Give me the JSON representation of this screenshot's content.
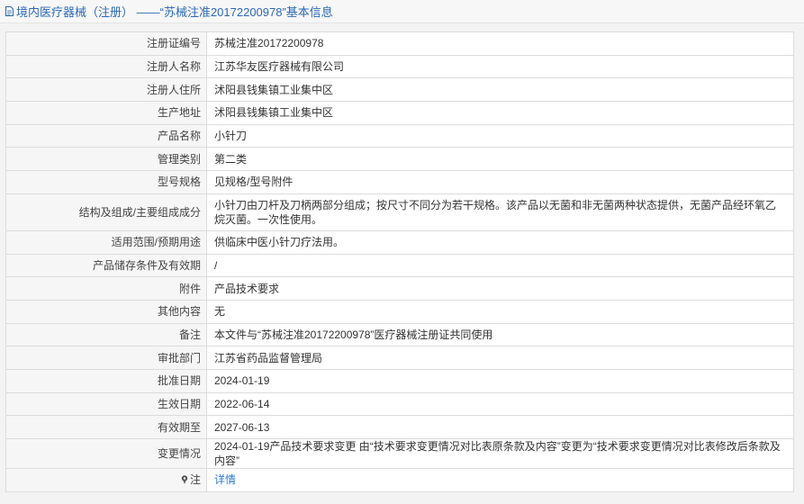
{
  "header": {
    "title": "境内医疗器械（注册） ——“苏械注准20172200978”基本信息"
  },
  "rows": [
    {
      "label": "注册证编号",
      "value": "苏械注准20172200978"
    },
    {
      "label": "注册人名称",
      "value": "江苏华友医疗器械有限公司"
    },
    {
      "label": "注册人住所",
      "value": "沭阳县钱集镇工业集中区"
    },
    {
      "label": "生产地址",
      "value": "沭阳县钱集镇工业集中区"
    },
    {
      "label": "产品名称",
      "value": "小针刀"
    },
    {
      "label": "管理类别",
      "value": "第二类"
    },
    {
      "label": "型号规格",
      "value": "见规格/型号附件"
    },
    {
      "label": "结构及组成/主要组成成分",
      "value": "小针刀由刀杆及刀柄两部分组成；按尺寸不同分为若干规格。该产品以无菌和非无菌两种状态提供，无菌产品经环氧乙烷灭菌。一次性使用。"
    },
    {
      "label": "适用范围/预期用途",
      "value": "供临床中医小针刀疗法用。"
    },
    {
      "label": "产品储存条件及有效期",
      "value": "/"
    },
    {
      "label": "附件",
      "value": "产品技术要求"
    },
    {
      "label": "其他内容",
      "value": "无"
    },
    {
      "label": "备注",
      "value": "本文件与“苏械注准20172200978”医疗器械注册证共同使用"
    },
    {
      "label": "审批部门",
      "value": "江苏省药品监督管理局"
    },
    {
      "label": "批准日期",
      "value": "2024-01-19"
    },
    {
      "label": "生效日期",
      "value": "2022-06-14"
    },
    {
      "label": "有效期至",
      "value": "2027-06-13"
    },
    {
      "label": "变更情况",
      "value": "2024-01-19产品技术要求变更 由“技术要求变更情况对比表原条款及内容”变更为“技术要求变更情况对比表修改后条款及内容”"
    }
  ],
  "note_row": {
    "label": "注",
    "link_text": "详情",
    "icon": "pin-icon"
  },
  "colors": {
    "title": "#2c69b7",
    "link": "#2c7bd6",
    "label_bg": "#f6f6f6",
    "border": "#dcdcdc"
  }
}
